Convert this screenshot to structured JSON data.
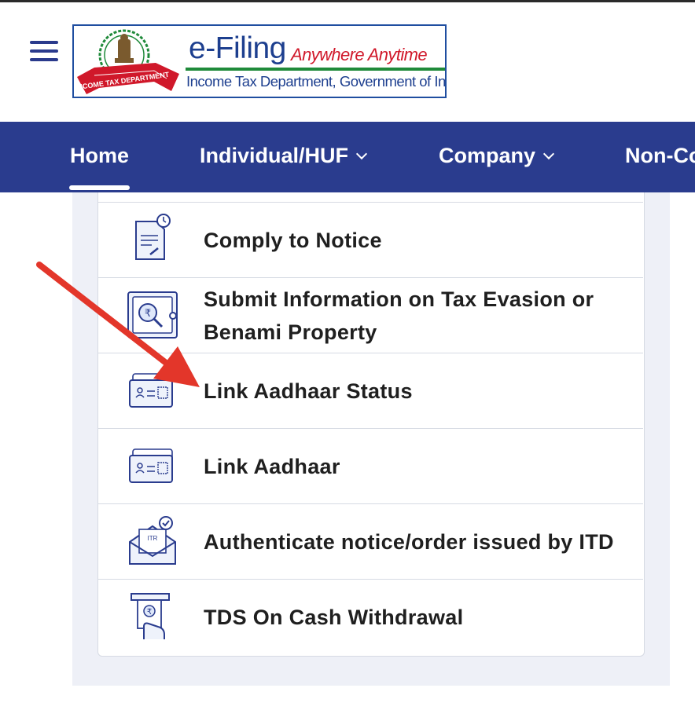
{
  "header": {
    "logo": {
      "brand": "e-Filing",
      "tagline": "Anywhere Anytime",
      "department": "Income Tax Department, Government of India",
      "ribbon_text": "INCOME TAX DEPARTMENT"
    }
  },
  "nav": {
    "items": [
      {
        "label": "Home",
        "active": true,
        "dropdown": false
      },
      {
        "label": "Individual/HUF",
        "dropdown": true
      },
      {
        "label": "Company",
        "dropdown": true
      },
      {
        "label": "Non-Co",
        "dropdown": false
      }
    ]
  },
  "services": {
    "items": [
      {
        "label": "Comply to Notice",
        "icon": "document-clock-icon"
      },
      {
        "label": "Submit Information on Tax Evasion or Benami Property",
        "icon": "safe-magnifier-icon"
      },
      {
        "label": "Link Aadhaar Status",
        "icon": "aadhaar-card-icon"
      },
      {
        "label": "Link Aadhaar",
        "icon": "aadhaar-card-icon"
      },
      {
        "label": "Authenticate notice/order issued by ITD",
        "icon": "itr-envelope-check-icon"
      },
      {
        "label": "TDS On Cash Withdrawal",
        "icon": "atm-cash-icon"
      }
    ]
  },
  "annotation": {
    "color": "#e3362a",
    "points_to": "Link Aadhaar Status"
  },
  "colors": {
    "nav_bg": "#2a3c8e",
    "brand_blue": "#1d3f8f",
    "tagline_red": "#d0182a",
    "panel_bg": "#eef0f7"
  }
}
